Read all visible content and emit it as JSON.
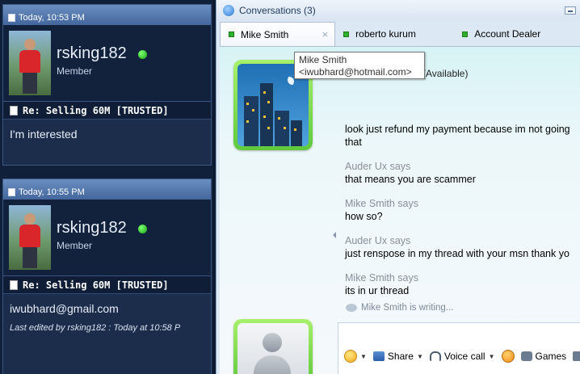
{
  "forum": {
    "posts": [
      {
        "timestamp": "Today, 10:53 PM",
        "username": "rsking182",
        "usertitle": "Member",
        "thread_title": "Re: Selling 60M [TRUSTED]",
        "message": "I'm interested"
      },
      {
        "timestamp": "Today, 10:55 PM",
        "username": "rsking182",
        "usertitle": "Member",
        "thread_title": "Re: Selling 60M [TRUSTED]",
        "message": "iwubhard@gmail.com",
        "edited": "Last edited by rsking182 : Today at 10:58 P"
      }
    ]
  },
  "chat": {
    "window_title": "Conversations (3)",
    "tabs": [
      {
        "label": "Mike Smith",
        "close": "×"
      },
      {
        "label": "roberto kurum"
      },
      {
        "label": "Account Dealer"
      }
    ],
    "tooltip": {
      "name": "Mike Smith",
      "email": "<iwubhard@hotmail.com>"
    },
    "status": "(Available)",
    "messages": [
      {
        "text": "look just refund my payment because im not going"
      },
      {
        "text": "that"
      },
      {
        "sender": "Auder Ux says",
        "text": "that means you are scammer"
      },
      {
        "sender": "Mike Smith says",
        "text": "how so?"
      },
      {
        "sender": "Auder Ux says",
        "text": "just renspose in my thread with your msn thank yo"
      },
      {
        "sender": "Mike Smith says",
        "text": "its in ur thread"
      }
    ],
    "typing_status": "Mike Smith is writing...",
    "toolbar": {
      "share": "Share",
      "voice_call": "Voice call",
      "games": "Games"
    },
    "status_color": "#2fb12b"
  }
}
